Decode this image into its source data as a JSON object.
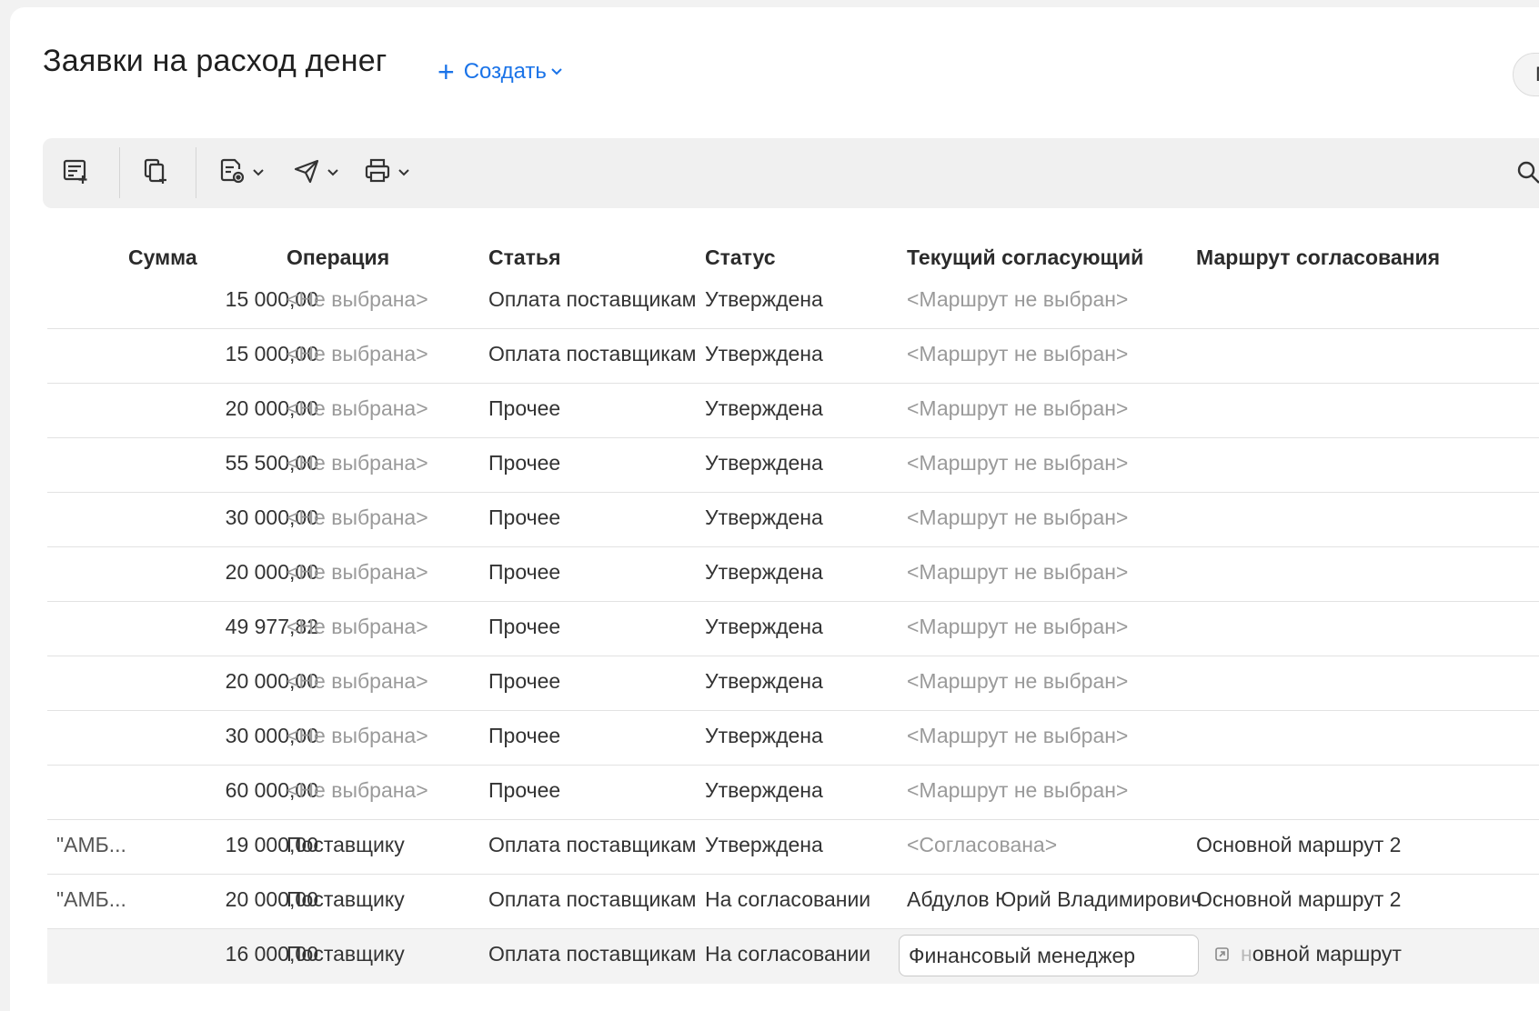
{
  "header": {
    "title": "Заявки на расход денег",
    "create_label": "Создать",
    "pill_text": "Г"
  },
  "toolbar": {
    "icons": [
      "new-record-icon",
      "copy-icon",
      "document-settings-icon",
      "send-icon",
      "print-icon",
      "search-icon"
    ]
  },
  "colors": {
    "accent": "#1a73e8",
    "placeholder": "#9a9a9a",
    "row_divider": "#e2e2e2"
  },
  "table": {
    "columns": {
      "sum": "Сумма",
      "operation": "Операция",
      "article": "Статья",
      "status": "Статус",
      "approver": "Текущий согласующий",
      "route": "Маршрут согласования"
    },
    "rows": [
      {
        "client": "",
        "sum": "15 000,00",
        "operation": "<Не выбрана>",
        "article": "Оплата поставщикам",
        "status": "Утверждена",
        "approver": "<Маршрут не выбран>",
        "route": ""
      },
      {
        "client": "",
        "sum": "15 000,00",
        "operation": "<Не выбрана>",
        "article": "Оплата поставщикам",
        "status": "Утверждена",
        "approver": "<Маршрут не выбран>",
        "route": ""
      },
      {
        "client": "",
        "sum": "20 000,00",
        "operation": "<Не выбрана>",
        "article": "Прочее",
        "status": "Утверждена",
        "approver": "<Маршрут не выбран>",
        "route": ""
      },
      {
        "client": "",
        "sum": "55 500,00",
        "operation": "<Не выбрана>",
        "article": "Прочее",
        "status": "Утверждена",
        "approver": "<Маршрут не выбран>",
        "route": ""
      },
      {
        "client": "",
        "sum": "30 000,00",
        "operation": "<Не выбрана>",
        "article": "Прочее",
        "status": "Утверждена",
        "approver": "<Маршрут не выбран>",
        "route": ""
      },
      {
        "client": "",
        "sum": "20 000,00",
        "operation": "<Не выбрана>",
        "article": "Прочее",
        "status": "Утверждена",
        "approver": "<Маршрут не выбран>",
        "route": ""
      },
      {
        "client": "",
        "sum": "49 977,82",
        "operation": "<Не выбрана>",
        "article": "Прочее",
        "status": "Утверждена",
        "approver": "<Маршрут не выбран>",
        "route": ""
      },
      {
        "client": "",
        "sum": "20 000,00",
        "operation": "<Не выбрана>",
        "article": "Прочее",
        "status": "Утверждена",
        "approver": "<Маршрут не выбран>",
        "route": ""
      },
      {
        "client": "",
        "sum": "30 000,00",
        "operation": "<Не выбрана>",
        "article": "Прочее",
        "status": "Утверждена",
        "approver": "<Маршрут не выбран>",
        "route": ""
      },
      {
        "client": "",
        "sum": "60 000,00",
        "operation": "<Не выбрана>",
        "article": "Прочее",
        "status": "Утверждена",
        "approver": "<Маршрут не выбран>",
        "route": ""
      },
      {
        "client": "\"АМБ...",
        "sum": "19 000,00",
        "operation": "Поставщику",
        "article": "Оплата поставщикам",
        "status": "Утверждена",
        "approver": "<Согласована>",
        "route": "Основной маршрут 2"
      },
      {
        "client": "\"АМБ...",
        "sum": "20 000,00",
        "operation": "Поставщику",
        "article": "Оплата поставщикам",
        "status": "На согласовании",
        "approver": "Абдулов Юрий Владимирович",
        "route": "Основной маршрут 2"
      },
      {
        "client": "",
        "sum": "16 000,00",
        "operation": "Поставщику",
        "article": "Оплата поставщикам",
        "status": "На согласовании",
        "approver": "Финансовый менеджер",
        "route_faded": "н",
        "route": "овной маршрут"
      }
    ]
  }
}
